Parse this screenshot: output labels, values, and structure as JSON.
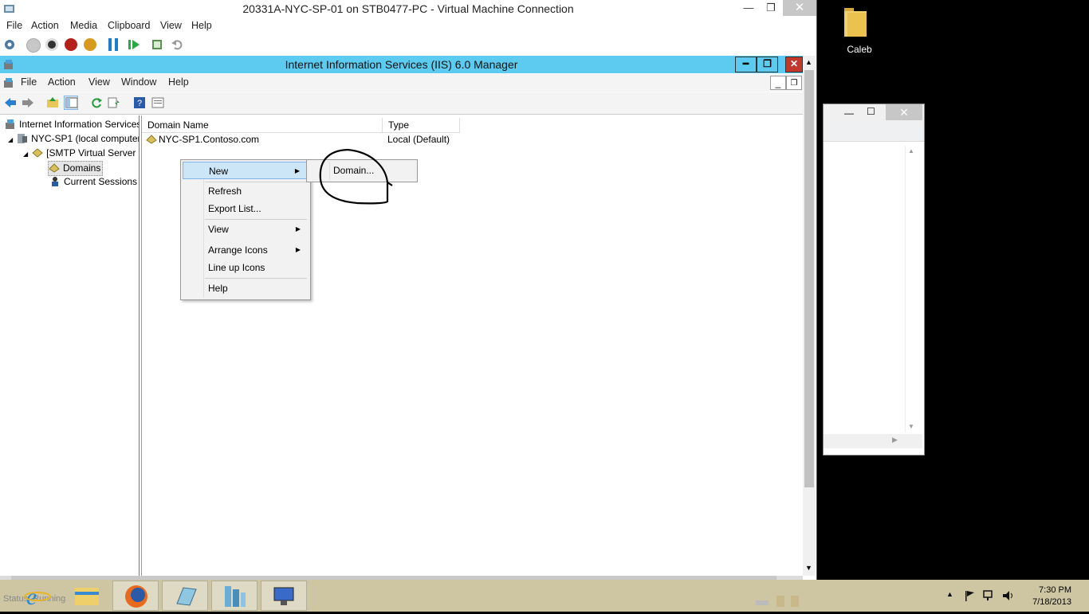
{
  "vm": {
    "title": "20331A-NYC-SP-01 on STB0477-PC - Virtual Machine Connection",
    "menu": [
      "File",
      "Action",
      "Media",
      "Clipboard",
      "View",
      "Help"
    ]
  },
  "iis": {
    "title": "Internet Information Services (IIS) 6.0 Manager",
    "menu": [
      "File",
      "Action",
      "View",
      "Window",
      "Help"
    ]
  },
  "tree": {
    "root": "Internet Information Services",
    "computer": "NYC-SP1 (local computer)",
    "smtp": "[SMTP Virtual Server",
    "domains": "Domains",
    "sessions": "Current Sessions"
  },
  "list": {
    "columns": [
      "Domain Name",
      "Type"
    ],
    "rows": [
      {
        "name": "NYC-SP1.Contoso.com",
        "type": "Local (Default)"
      }
    ]
  },
  "context_menu": {
    "items": [
      "New",
      "Refresh",
      "Export List...",
      "View",
      "Arrange Icons",
      "Line up Icons",
      "Help"
    ],
    "submenu": [
      "Domain..."
    ]
  },
  "desktop": {
    "folder_label": "Caleb"
  },
  "taskbar": {
    "status": "Status: Running",
    "time": "7:30 PM",
    "date": "7/18/2013"
  },
  "colors": {
    "iis_title": "#5ccbef",
    "menu_highlight": "#cde6f7",
    "taskbar": "#cec6a3"
  }
}
